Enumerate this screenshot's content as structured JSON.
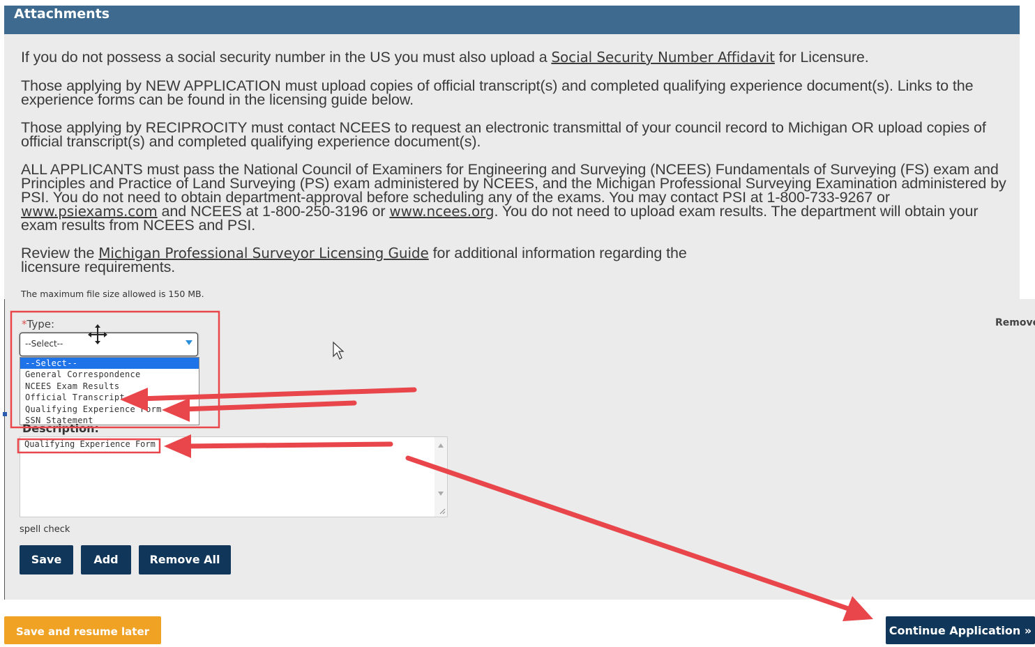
{
  "section": {
    "title": "Attachments"
  },
  "instructions": {
    "p1_before": "If you do not possess a social security number in the US you must also upload a ",
    "p1_link": "Social Security Number Affidavit",
    "p1_after": " for Licensure.",
    "p2": "Those applying by NEW APPLICATION must upload copies of official transcript(s) and completed qualifying experience document(s). Links to the experience forms can be found in the licensing guide below.",
    "p3": "Those applying by RECIPROCITY must contact NCEES to request an electronic transmittal of your council record to Michigan OR upload copies of official transcript(s) and completed qualifying experience document(s).",
    "p4_a": "ALL APPLICANTS must pass the National Council of Examiners for Engineering and Surveying (NCEES) Fundamentals of Surveying (FS) exam and Principles and Practice of Land Surveying (PS) exam administered by NCEES, and the Michigan Professional Surveying Examination administered by PSI.  You do not need to obtain department-approval before scheduling any of the exams. You may contact PSI at 1-800-733-9267 or ",
    "p4_link1": "www.psiexams.com",
    "p4_b": " and NCEES at 1-800-250-3196 or ",
    "p4_link2": "www.ncees.org",
    "p4_c": ". You do not need to upload exam results. The department will obtain your exam results from NCEES and PSI.",
    "p5_before": "Review the ",
    "p5_link": "Michigan Professional Surveyor Licensing Guide",
    "p5_after": " for additional information regarding the licensure requirements.",
    "max_size": "The maximum file size allowed is 150 MB."
  },
  "form": {
    "type_required": "*",
    "type_label": "Type:",
    "type_value": "--Select--",
    "type_options": [
      "--Select--",
      "General Correspondence",
      "NCEES Exam Results",
      "Official Transcript",
      "Qualifying Experience Form",
      "SSN Statement"
    ],
    "description_label": "Description:",
    "description_value": "Qualifying Experience Form",
    "spell_check": "spell check",
    "remove_link": "Remove"
  },
  "buttons": {
    "save": "Save",
    "add": "Add",
    "remove_all": "Remove All",
    "save_resume": "Save and resume later",
    "continue": "Continue Application »"
  },
  "colors": {
    "header": "#3d6a8e",
    "navy_button": "#10365a",
    "orange_button": "#f0a224",
    "annotation_red": "#e8464a"
  }
}
